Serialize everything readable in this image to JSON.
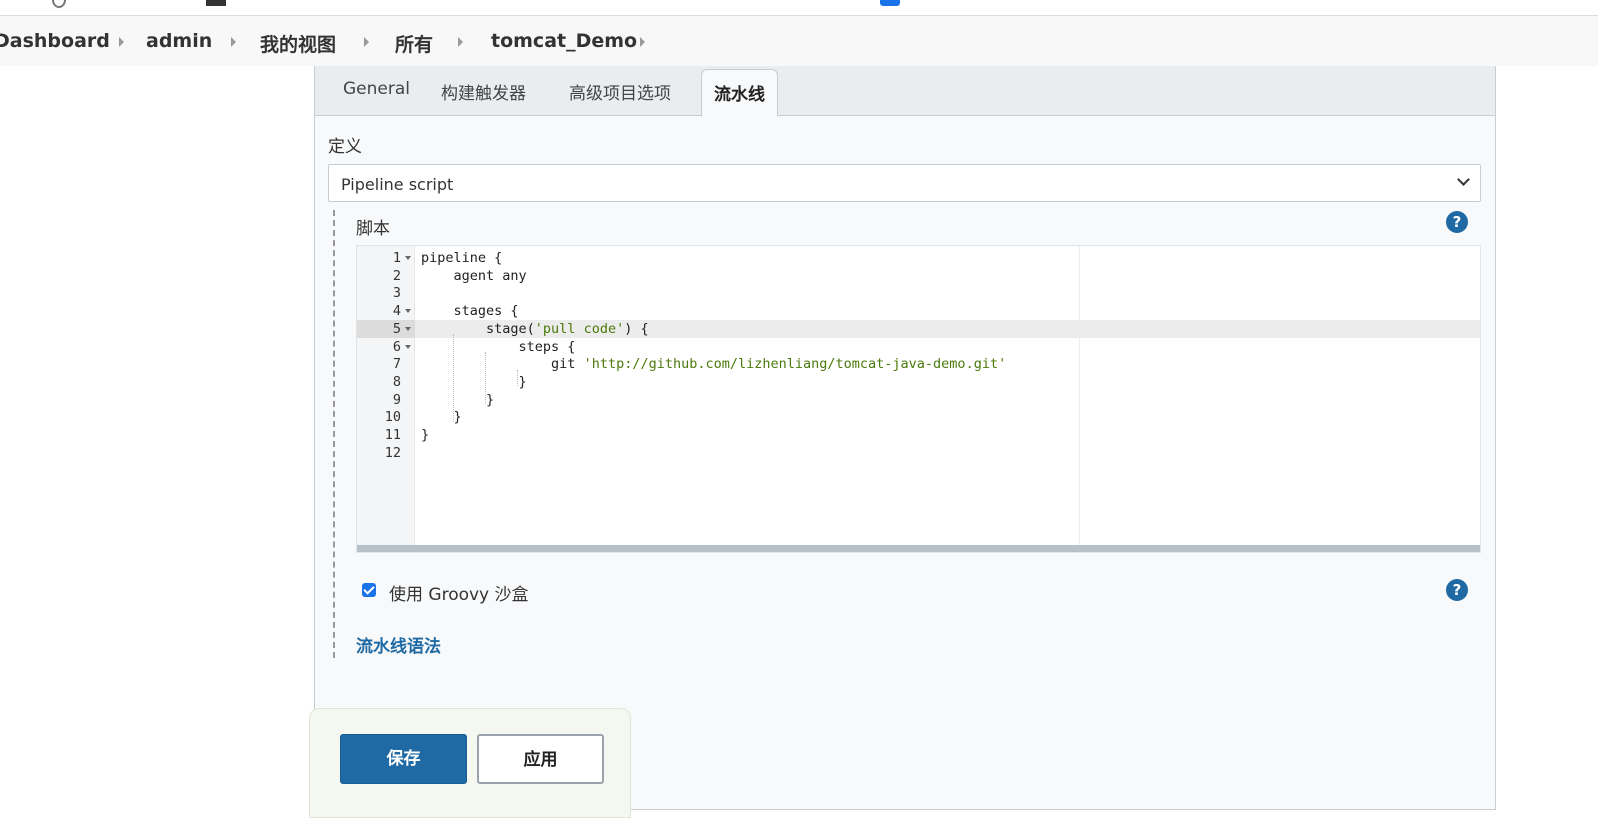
{
  "breadcrumb": {
    "items": [
      "Dashboard",
      "admin",
      "我的视图",
      "所有",
      "tomcat_Demo"
    ]
  },
  "tabs": {
    "general": "General",
    "triggers": "构建触发器",
    "advanced": "高级项目选项",
    "pipeline": "流水线"
  },
  "definition": {
    "label": "定义",
    "selected": "Pipeline script"
  },
  "script": {
    "label": "脚本",
    "lines": [
      {
        "num": "1",
        "text": "pipeline {"
      },
      {
        "num": "2",
        "text": "    agent any"
      },
      {
        "num": "3",
        "text": ""
      },
      {
        "num": "4",
        "text": "    stages {"
      },
      {
        "num": "5",
        "pre": "        stage(",
        "str": "'pull code'",
        "post": ") {"
      },
      {
        "num": "6",
        "text": "            steps {"
      },
      {
        "num": "7",
        "pre": "                git ",
        "str": "'http://github.com/lizhenliang/tomcat-java-demo.git'",
        "post": ""
      },
      {
        "num": "8",
        "text": "            }"
      },
      {
        "num": "9",
        "text": "        }"
      },
      {
        "num": "10",
        "text": "    }"
      },
      {
        "num": "11",
        "text": "}"
      },
      {
        "num": "12",
        "text": ""
      }
    ]
  },
  "sandbox": {
    "label": "使用 Groovy 沙盒",
    "checked": true
  },
  "syntax_link": "流水线语法",
  "help_icon": "?",
  "buttons": {
    "save": "保存",
    "apply": "应用"
  },
  "colors": {
    "accent": "#1f6aa5",
    "string": "#4a7a0c"
  }
}
